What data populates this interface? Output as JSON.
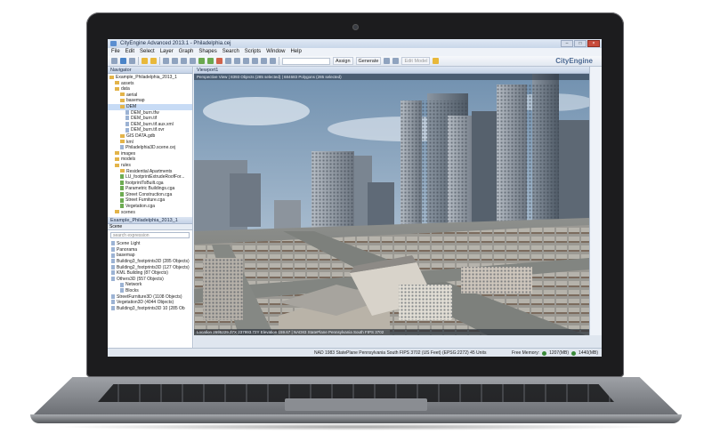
{
  "app": {
    "title": "CityEngine Advanced 2013.1 - Philadelphia.cej",
    "brand": "CityEngine"
  },
  "menu": [
    "File",
    "Edit",
    "Select",
    "Layer",
    "Graph",
    "Shapes",
    "Search",
    "Scripts",
    "Window",
    "Help"
  ],
  "toolbar": {
    "assign_label": "Assign",
    "generate_label": "Generate",
    "edit_model_label": "Edit Model"
  },
  "navigator": {
    "title": "Navigator",
    "items": [
      {
        "label": "Example_Philadelphia_2013_1",
        "kind": "project",
        "depth": 0
      },
      {
        "label": "assets",
        "kind": "folder",
        "depth": 1
      },
      {
        "label": "data",
        "kind": "folder",
        "depth": 1
      },
      {
        "label": "aerial",
        "kind": "folder",
        "depth": 2
      },
      {
        "label": "basemap",
        "kind": "folder",
        "depth": 2
      },
      {
        "label": "DEM",
        "kind": "folder",
        "depth": 2
      },
      {
        "label": "DEM_burn.tfw",
        "kind": "file",
        "depth": 3
      },
      {
        "label": "DEM_burn.tif",
        "kind": "file",
        "depth": 3
      },
      {
        "label": "DEM_burn.tif.aux.xml",
        "kind": "file",
        "depth": 3
      },
      {
        "label": "DEM_burn.tif.ovr",
        "kind": "file",
        "depth": 3
      },
      {
        "label": "GIS DATA.gdb",
        "kind": "folder",
        "depth": 2
      },
      {
        "label": "kml",
        "kind": "folder",
        "depth": 2
      },
      {
        "label": "Philadelphia3D.scene.cej",
        "kind": "file",
        "depth": 2
      },
      {
        "label": "images",
        "kind": "folder",
        "depth": 1
      },
      {
        "label": "models",
        "kind": "folder",
        "depth": 1
      },
      {
        "label": "rules",
        "kind": "folder",
        "depth": 1
      },
      {
        "label": "Residential Apartments",
        "kind": "folder",
        "depth": 2
      },
      {
        "label": "LU_footprintExtrudeRoofFor...",
        "kind": "rule",
        "depth": 2
      },
      {
        "label": "footprintToBuilt.cga",
        "kind": "rule",
        "depth": 2
      },
      {
        "label": "Parametric Buildings.cga",
        "kind": "rule",
        "depth": 2
      },
      {
        "label": "Street Construction.cga",
        "kind": "rule",
        "depth": 2
      },
      {
        "label": "Street Furniture.cga",
        "kind": "rule",
        "depth": 2
      },
      {
        "label": "Vegetation.cga",
        "kind": "rule",
        "depth": 2
      },
      {
        "label": "scenes",
        "kind": "folder",
        "depth": 1
      }
    ]
  },
  "scene_panel": {
    "title": "Example_Philadelphia_2013_1",
    "tab": "Scene",
    "search_placeholder": "search expression",
    "items": [
      {
        "label": "Scene Light"
      },
      {
        "label": "Panorama"
      },
      {
        "label": "basemap"
      },
      {
        "label": "Building3_footprints3D (285 Objects)"
      },
      {
        "label": "Building2_footprints3D (127 Objects)"
      },
      {
        "label": "KML Building (87 Objects)"
      },
      {
        "label": "Others3D (557 Objects)"
      },
      {
        "label": "Network"
      },
      {
        "label": "Blocks"
      },
      {
        "label": "StreetFurniture3D (1108 Objects)"
      },
      {
        "label": "Vegetation3D (4044 Objects)"
      },
      {
        "label": "Building3_footprints3D 10 (285 Ob"
      }
    ]
  },
  "viewport": {
    "title": "Viewport1",
    "info": "Perspective View  |  8393 Objects  (285 selected)  |  684683 Polygons  (285 selected)",
    "status": "Location 2695229.37X 237993.72Y  Elevation 159.67  |  NAD83 StatePlane Pennsylvania South FIPS 3702"
  },
  "statusbar": {
    "coords": "NAD 1983 StatePlane Pennsylvania South FIPS 3702 (US Feet) (EPSG:2272)  45 Units",
    "memory_label": "Free Memory:",
    "memory_a": "1207(MB)",
    "memory_b": "1440(MB)"
  },
  "colors": {
    "sky_top": "#6f8fae",
    "sky_bottom": "#c9d6e2",
    "accent": "#4d6a93"
  }
}
